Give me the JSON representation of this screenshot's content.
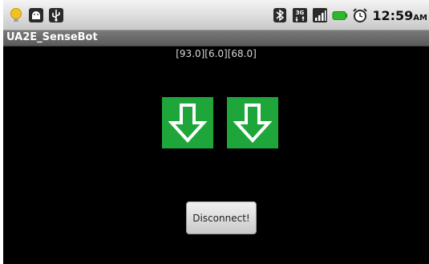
{
  "status_bar": {
    "time": "12:59",
    "time_suffix": "AM",
    "network_type": "3G",
    "left_icons": [
      "lightbulb-notification-icon",
      "android-notification-icon",
      "usb-notification-icon"
    ],
    "right_icons": [
      "bluetooth-icon",
      "network-3g-icon",
      "signal-strength-icon",
      "battery-icon",
      "alarm-clock-icon"
    ],
    "colors": {
      "battery": "#2fb82b",
      "lightbulb": "#f4c21f"
    }
  },
  "app": {
    "title": "UA2E_SenseBot"
  },
  "sensor_readout": "[93.0][6.0][68.0]",
  "motors": {
    "left": {
      "direction": "down",
      "icon": "arrow-down-icon"
    },
    "right": {
      "direction": "down",
      "icon": "arrow-down-icon"
    },
    "color": "#1fa63b"
  },
  "disconnect_button": {
    "label": "Disconnect!"
  }
}
